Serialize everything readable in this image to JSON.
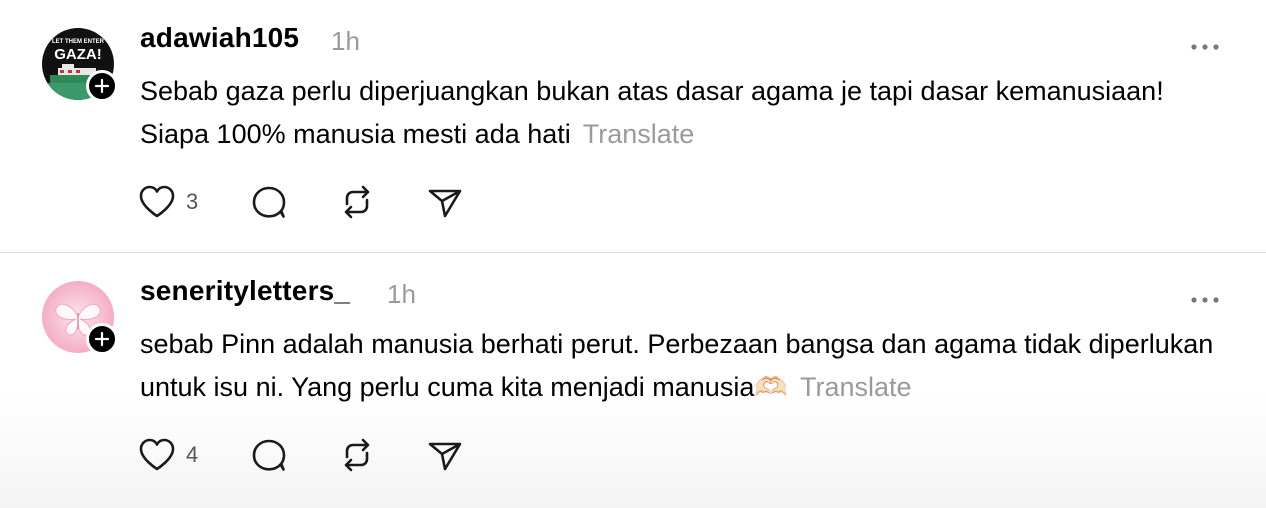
{
  "posts": [
    {
      "username": "adawiah105",
      "time": "1h",
      "text": "Sebab gaza perlu diperjuangkan bukan atas dasar agama je tapi dasar kemanusiaan! Siapa 100% manusia mesti ada hati",
      "translate_label": "Translate",
      "likes": "3",
      "avatar_text_top": "LET THEM ENTER",
      "avatar_text_main": "GAZA!"
    },
    {
      "username": "senerityletters_",
      "time": "1h",
      "text": "sebab Pinn adalah manusia berhati perut. Perbezaan bangsa dan agama tidak diperlukan untuk isu ni. Yang perlu cuma kita menjadi manusia🫶🏻",
      "translate_label": "Translate",
      "likes": "4"
    }
  ],
  "icons": {
    "like": "heart-icon",
    "reply": "comment-icon",
    "repost": "repost-icon",
    "share": "send-icon",
    "more": "more-icon",
    "follow": "plus-icon"
  }
}
